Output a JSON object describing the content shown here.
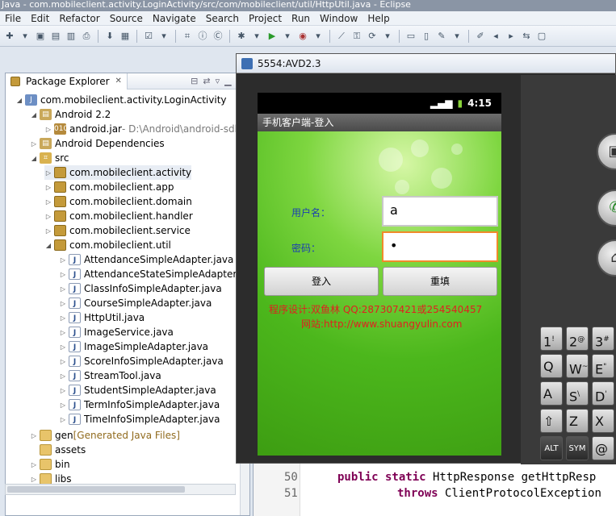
{
  "window": {
    "title": "Java - com.mobileclient.activity.LoginActivity/src/com/mobileclient/util/HttpUtil.java - Eclipse"
  },
  "menu": [
    "File",
    "Edit",
    "Refactor",
    "Source",
    "Navigate",
    "Search",
    "Project",
    "Run",
    "Window",
    "Help"
  ],
  "package_explorer": {
    "tab_label": "Package Explorer",
    "tree": [
      {
        "label": "com.mobileclient.activity.LoginActivity",
        "icon": "project-icon"
      },
      {
        "label": "Android 2.2",
        "icon": "library-icon"
      },
      {
        "label": "android.jar",
        "suffix": " - D:\\Android\\android-sdk-",
        "icon": "jar-icon"
      },
      {
        "label": "Android Dependencies",
        "icon": "library-icon"
      },
      {
        "label": "src",
        "icon": "source-folder-icon"
      },
      {
        "label": "com.mobileclient.activity",
        "icon": "package-icon"
      },
      {
        "label": "com.mobileclient.app",
        "icon": "package-icon"
      },
      {
        "label": "com.mobileclient.domain",
        "icon": "package-icon"
      },
      {
        "label": "com.mobileclient.handler",
        "icon": "package-icon"
      },
      {
        "label": "com.mobileclient.service",
        "icon": "package-icon"
      },
      {
        "label": "com.mobileclient.util",
        "icon": "package-icon"
      },
      {
        "label": "AttendanceSimpleAdapter.java",
        "icon": "java-file-icon"
      },
      {
        "label": "AttendanceStateSimpleAdapter.java",
        "icon": "java-file-icon"
      },
      {
        "label": "ClassInfoSimpleAdapter.java",
        "icon": "java-file-icon"
      },
      {
        "label": "CourseSimpleAdapter.java",
        "icon": "java-file-icon"
      },
      {
        "label": "HttpUtil.java",
        "icon": "java-file-icon"
      },
      {
        "label": "ImageService.java",
        "icon": "java-file-icon"
      },
      {
        "label": "ImageSimpleAdapter.java",
        "icon": "java-file-icon"
      },
      {
        "label": "ScoreInfoSimpleAdapter.java",
        "icon": "java-file-icon"
      },
      {
        "label": "StreamTool.java",
        "icon": "java-file-icon"
      },
      {
        "label": "StudentSimpleAdapter.java",
        "icon": "java-file-icon"
      },
      {
        "label": "TermInfoSimpleAdapter.java",
        "icon": "java-file-icon"
      },
      {
        "label": "TimeInfoSimpleAdapter.java",
        "icon": "java-file-icon"
      },
      {
        "label": "gen",
        "suffix": " [Generated Java Files]",
        "icon": "folder-icon"
      },
      {
        "label": "assets",
        "icon": "folder-icon"
      },
      {
        "label": "bin",
        "icon": "folder-icon"
      },
      {
        "label": "libs",
        "icon": "folder-icon"
      }
    ]
  },
  "editor": {
    "lines": [
      {
        "num": "50",
        "code_kw": "public static",
        "code_rest": " HttpResponse getHttpResp"
      },
      {
        "num": "51",
        "code_kw": "throws",
        "code_rest": " ClientProtocolException"
      }
    ]
  },
  "avd": {
    "title": "5554:AVD2.3",
    "clock": "4:15",
    "app_title": "手机客户端-登入",
    "username_label": "用户名：",
    "username_value": "a",
    "password_label": "密码：",
    "password_value": "•",
    "login_button": "登入",
    "reset_button": "重填",
    "credit_line1": "程序设计:双鱼林    QQ:287307421或254540457",
    "credit_line2": "网站:http://www.shuangyulin.com",
    "keys": [
      {
        "main": "1",
        "sup": "!"
      },
      {
        "main": "2",
        "sup": "@"
      },
      {
        "main": "3",
        "sup": "#"
      },
      {
        "main": "Q",
        "sup": ""
      },
      {
        "main": "W",
        "sup": "~"
      },
      {
        "main": "E",
        "sup": "\""
      },
      {
        "main": "A",
        "sup": ""
      },
      {
        "main": "S",
        "sup": "\\"
      },
      {
        "main": "D",
        "sup": "'"
      },
      {
        "main": "Z",
        "sup": ""
      },
      {
        "main": "X",
        "sup": ""
      },
      {
        "main": "ALT",
        "sup": ""
      },
      {
        "main": "SYM",
        "sup": ""
      },
      {
        "main": "@",
        "sup": ""
      }
    ]
  }
}
